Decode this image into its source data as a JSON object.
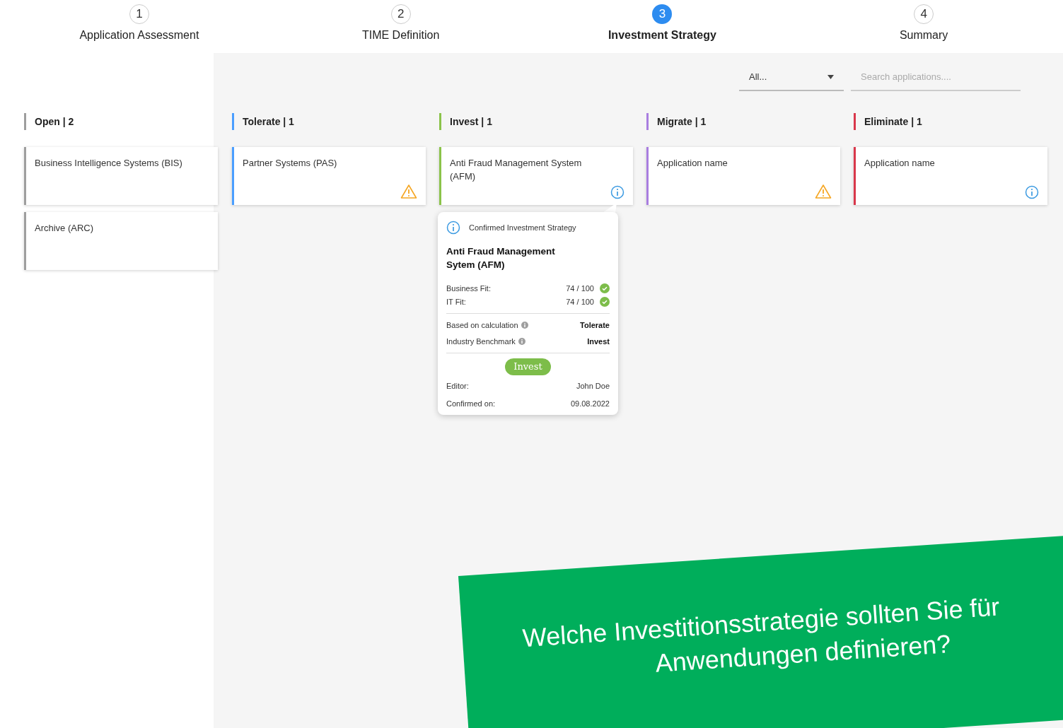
{
  "steps": [
    {
      "number": "1",
      "label": "Application Assessment",
      "selected": false
    },
    {
      "number": "2",
      "label": "TIME Definition",
      "selected": false
    },
    {
      "number": "3",
      "label": "Investment Strategy",
      "selected": true
    },
    {
      "number": "4",
      "label": "Summary",
      "selected": false
    }
  ],
  "filter": {
    "value": "All..."
  },
  "search": {
    "placeholder": "Search applications...."
  },
  "columns": [
    {
      "title": "Open | 2",
      "color": "#9e9e9e",
      "cards": [
        {
          "name": "Business Intelligence Systems (BIS)"
        },
        {
          "name": "Archive (ARC)"
        }
      ]
    },
    {
      "title": "Tolerate | 1",
      "color": "#4a9eff",
      "cards": [
        {
          "name": "Partner Systems (PAS)",
          "kind": "warning"
        }
      ]
    },
    {
      "title": "Invest | 1",
      "color": "#8bc34a",
      "cards": [
        {
          "name": "Anti Fraud Management System (AFM)",
          "kind": "info"
        }
      ]
    },
    {
      "title": "Migrate | 1",
      "color": "#a97ee0",
      "cards": [
        {
          "name": "Application name",
          "kind": "warning"
        }
      ]
    },
    {
      "title": "Eliminate | 1",
      "color": "#d9374b",
      "cards": [
        {
          "name": "Application name",
          "kind": "info"
        }
      ]
    }
  ],
  "popover": {
    "header": "Confirmed Investment Strategy",
    "title": "Anti Fraud Management Sytem (AFM)",
    "fits": [
      {
        "label": "Business Fit:",
        "value": "74 / 100"
      },
      {
        "label": "IT Fit:",
        "value": "74 / 100"
      }
    ],
    "strategies": [
      {
        "label": "Based on calculation",
        "value": "Tolerate"
      },
      {
        "label": "Industry Benchmark",
        "value": "Invest"
      }
    ],
    "button": "Invest",
    "details": [
      {
        "label": "Editor:",
        "value": "John Doe"
      },
      {
        "label": "Confirmed on:",
        "value": "09.08.2022"
      }
    ]
  },
  "banner": {
    "lines": [
      "Welche Investitionsstrategie sollten Sie für",
      "Anwendungen definieren?"
    ]
  }
}
